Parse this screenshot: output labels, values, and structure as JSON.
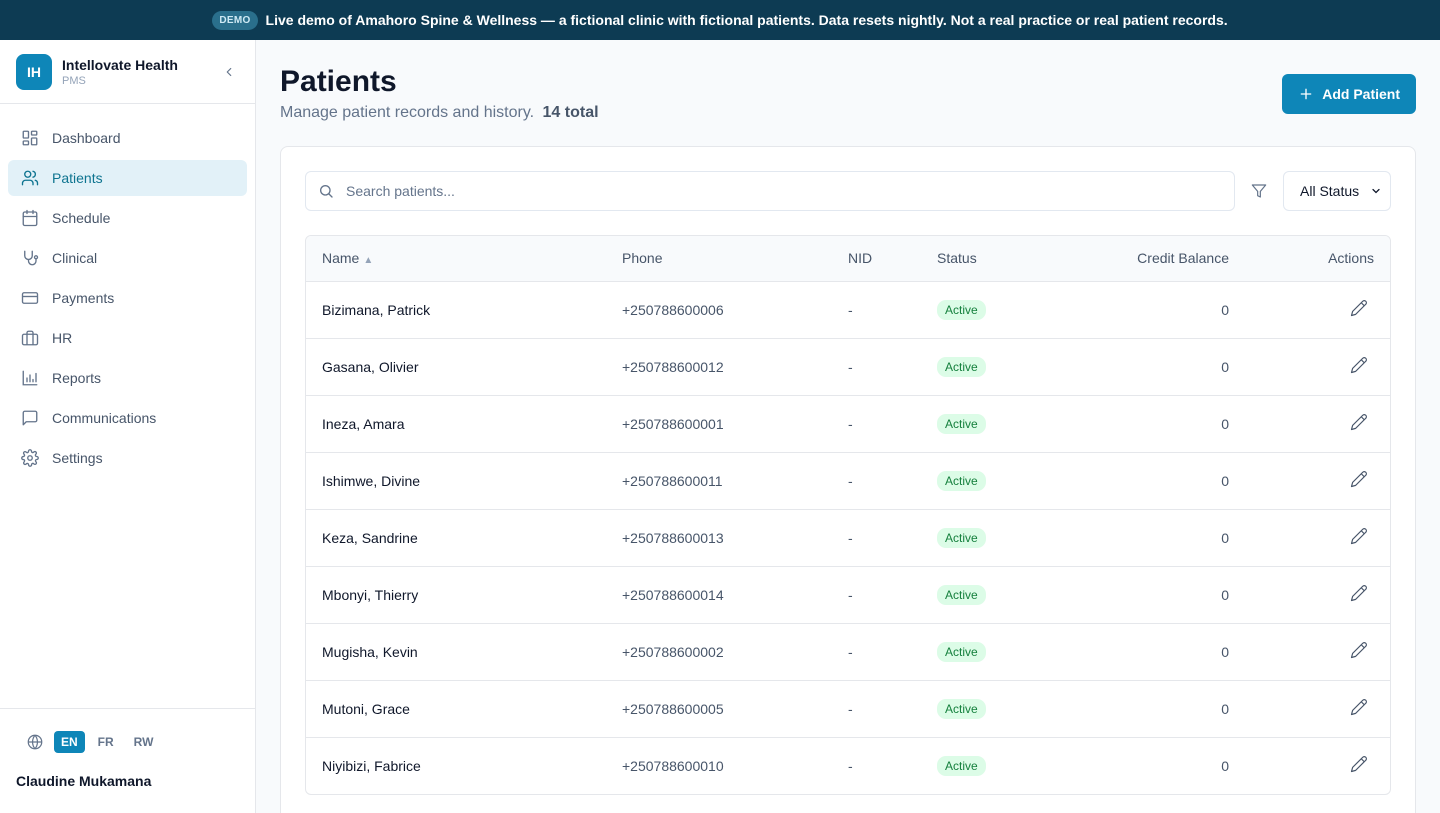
{
  "banner": {
    "badge": "DEMO",
    "text": "Live demo of Amahoro Spine & Wellness — a fictional clinic with fictional patients. Data resets nightly. Not a real practice or real patient records."
  },
  "brand": {
    "initials": "IH",
    "title": "Intellovate Health",
    "subtitle": "PMS"
  },
  "sidebar": {
    "items": [
      {
        "label": "Dashboard",
        "icon": "dashboard-icon"
      },
      {
        "label": "Patients",
        "icon": "users-icon"
      },
      {
        "label": "Schedule",
        "icon": "calendar-icon"
      },
      {
        "label": "Clinical",
        "icon": "stethoscope-icon"
      },
      {
        "label": "Payments",
        "icon": "credit-card-icon"
      },
      {
        "label": "HR",
        "icon": "briefcase-icon"
      },
      {
        "label": "Reports",
        "icon": "bar-chart-icon"
      },
      {
        "label": "Communications",
        "icon": "message-icon"
      },
      {
        "label": "Settings",
        "icon": "gear-icon"
      }
    ],
    "active": "Patients",
    "languages": [
      "EN",
      "FR",
      "RW"
    ],
    "active_language": "EN",
    "user_name": "Claudine Mukamana"
  },
  "page": {
    "title": "Patients",
    "subtitle": "Manage patient records and history.",
    "total": "14 total",
    "add_button": "Add Patient"
  },
  "search": {
    "placeholder": "Search patients..."
  },
  "filter": {
    "selected": "All Status"
  },
  "table": {
    "columns": [
      "Name",
      "Phone",
      "NID",
      "Status",
      "Credit Balance",
      "Actions"
    ],
    "rows": [
      {
        "name": "Bizimana, Patrick",
        "phone": "+250788600006",
        "nid": "-",
        "status": "Active",
        "credit": "0"
      },
      {
        "name": "Gasana, Olivier",
        "phone": "+250788600012",
        "nid": "-",
        "status": "Active",
        "credit": "0"
      },
      {
        "name": "Ineza, Amara",
        "phone": "+250788600001",
        "nid": "-",
        "status": "Active",
        "credit": "0"
      },
      {
        "name": "Ishimwe, Divine",
        "phone": "+250788600011",
        "nid": "-",
        "status": "Active",
        "credit": "0"
      },
      {
        "name": "Keza, Sandrine",
        "phone": "+250788600013",
        "nid": "-",
        "status": "Active",
        "credit": "0"
      },
      {
        "name": "Mbonyi, Thierry",
        "phone": "+250788600014",
        "nid": "-",
        "status": "Active",
        "credit": "0"
      },
      {
        "name": "Mugisha, Kevin",
        "phone": "+250788600002",
        "nid": "-",
        "status": "Active",
        "credit": "0"
      },
      {
        "name": "Mutoni, Grace",
        "phone": "+250788600005",
        "nid": "-",
        "status": "Active",
        "credit": "0"
      },
      {
        "name": "Niyibizi, Fabrice",
        "phone": "+250788600010",
        "nid": "-",
        "status": "Active",
        "credit": "0"
      }
    ]
  },
  "colors": {
    "accent": "#0e86b8",
    "banner": "#0d3b53",
    "status_active_bg": "#dcfce7",
    "status_active_text": "#15803d"
  }
}
